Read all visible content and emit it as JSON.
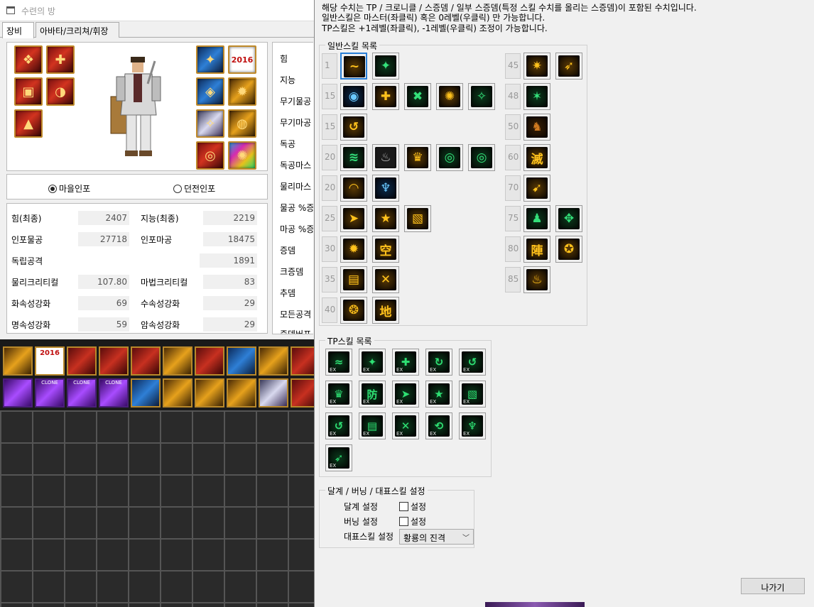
{
  "left_window": {
    "title": "수련의 방",
    "tabs": [
      "장비",
      "아바타/크리쳐/휘장"
    ],
    "equipment_badge": "2016",
    "radio": {
      "village": "마을인포",
      "dungeon": "던전인포",
      "selected": "village"
    },
    "stats": [
      {
        "label": "힘(최종)",
        "value": "2407"
      },
      {
        "label": "지능(최종)",
        "value": "2219"
      },
      {
        "label": "인포물공",
        "value": "27718"
      },
      {
        "label": "인포마공",
        "value": "18475"
      },
      {
        "label": "독립공격",
        "value": "1891"
      },
      {
        "label": "물리크리티컬",
        "value": "107.80"
      },
      {
        "label": "마법크리티컬",
        "value": "83"
      },
      {
        "label": "화속성강화",
        "value": "69"
      },
      {
        "label": "수속성강화",
        "value": "29"
      },
      {
        "label": "명속성강화",
        "value": "59"
      },
      {
        "label": "암속성강화",
        "value": "29"
      }
    ],
    "side_stats": [
      "힘",
      "지능",
      "무기물공",
      "무기마공",
      "독공",
      "독공마스",
      "물리마스",
      "물공 %증",
      "마공 %증",
      "증뎀",
      "크증뎀",
      "추뎀",
      "모든공격",
      "증뎀버프"
    ],
    "inventory_badge": "2016",
    "inventory_clone_label": "CLONE"
  },
  "skill_window": {
    "notice_lines": [
      "해당 수치는 TP / 크로니클 / 스증뎀 / 일부 스증뎀(특정 스킬 수치를 올리는 스증뎀)이 포함된 수치입니다.",
      "일반스킬은 마스터(좌클릭) 혹은 0레벨(우클릭) 만 가능합니다.",
      "TP스킬은 +1레벨(좌클릭), -1레벨(우클릭) 조정이 가능합니다."
    ],
    "general_skills_label": "일반스킬 목록",
    "general_left": [
      {
        "level": "1",
        "skills": [
          {
            "s": "~",
            "c": "g",
            "sel": true
          },
          {
            "s": "✦",
            "c": "t"
          }
        ]
      },
      {
        "level": "15",
        "skills": [
          {
            "s": "◉",
            "c": "b"
          },
          {
            "s": "✚",
            "c": "g"
          },
          {
            "s": "✖",
            "c": "t"
          },
          {
            "s": "✺",
            "c": "g"
          },
          {
            "s": "✧",
            "c": "t"
          }
        ]
      },
      {
        "level": "15",
        "skills": [
          {
            "s": "↺",
            "c": "g"
          }
        ]
      },
      {
        "level": "20",
        "skills": [
          {
            "s": "≋",
            "c": "t"
          },
          {
            "s": "♨",
            "c": "k"
          },
          {
            "s": "♛",
            "c": "g"
          },
          {
            "s": "◎",
            "c": "t"
          },
          {
            "s": "◎",
            "c": "t"
          }
        ]
      },
      {
        "level": "20",
        "skills": [
          {
            "s": "◠",
            "c": "g"
          },
          {
            "s": "♆",
            "c": "b"
          }
        ]
      },
      {
        "level": "25",
        "skills": [
          {
            "s": "➤",
            "c": "g"
          },
          {
            "s": "★",
            "c": "g"
          },
          {
            "s": "▧",
            "c": "g"
          }
        ]
      },
      {
        "level": "30",
        "skills": [
          {
            "s": "✹",
            "c": "g"
          },
          {
            "s": "空",
            "c": "g"
          }
        ]
      },
      {
        "level": "35",
        "skills": [
          {
            "s": "▤",
            "c": "g"
          },
          {
            "s": "✕",
            "c": "g"
          }
        ]
      },
      {
        "level": "40",
        "skills": [
          {
            "s": "❂",
            "c": "g"
          },
          {
            "s": "地",
            "c": "g"
          }
        ]
      }
    ],
    "general_right": [
      {
        "level": "45",
        "skills": [
          {
            "s": "✷",
            "c": "g"
          },
          {
            "s": "➶",
            "c": "g"
          }
        ]
      },
      {
        "level": "48",
        "skills": [
          {
            "s": "✶",
            "c": "t"
          }
        ]
      },
      {
        "level": "50",
        "skills": [
          {
            "s": "♞",
            "c": "e"
          }
        ]
      },
      {
        "level": "60",
        "skills": [
          {
            "s": "滅",
            "c": "g"
          }
        ]
      },
      {
        "level": "70",
        "skills": [
          {
            "s": "➹",
            "c": "g"
          }
        ]
      },
      {
        "level": "75",
        "skills": [
          {
            "s": "♟",
            "c": "t"
          },
          {
            "s": "✥",
            "c": "t"
          }
        ]
      },
      {
        "level": "80",
        "skills": [
          {
            "s": "陣",
            "c": "g"
          },
          {
            "s": "✪",
            "c": "g"
          }
        ]
      },
      {
        "level": "85",
        "skills": [
          {
            "s": "♨",
            "c": "g"
          }
        ]
      }
    ],
    "tp_skills_label": "TP스킬 목록",
    "tp_rows": [
      [
        "≈",
        "✦",
        "✚",
        "↻",
        "↺"
      ],
      [
        "♛",
        "防",
        "➤",
        "★",
        "▧"
      ],
      [
        "↺",
        "▤",
        "✕",
        "⟲",
        "♆"
      ],
      [
        "➶"
      ]
    ],
    "settings": {
      "label": "달계 / 버닝 / 대표스킬 설정",
      "dalgye_label": "달계 설정",
      "burning_label": "버닝 설정",
      "checkbox_text": "설정",
      "dalgye_checked": false,
      "burning_checked": false,
      "rep_label": "대표스킬 설정",
      "rep_value": "황룡의 진격"
    },
    "exit_button": "나가기"
  }
}
